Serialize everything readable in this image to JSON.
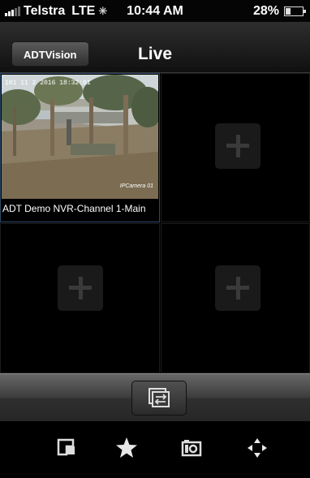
{
  "status_bar": {
    "carrier": "Telstra",
    "network": "LTE",
    "time": "10:44 AM",
    "battery": "28%",
    "battery_level": 0.28
  },
  "nav": {
    "back_label": "ADTVision",
    "title": "Live"
  },
  "grid": {
    "channels": [
      {
        "caption": "ADT Demo NVR-Channel 1-Main",
        "stamp": "101 11 2 2016 18:32:01",
        "camera": "IPCamera 01"
      }
    ]
  },
  "toolbar": {
    "icons": [
      "layout-switch-icon",
      "window-icon",
      "star-icon",
      "camera-snapshot-icon",
      "ptz-direction-icon"
    ]
  }
}
